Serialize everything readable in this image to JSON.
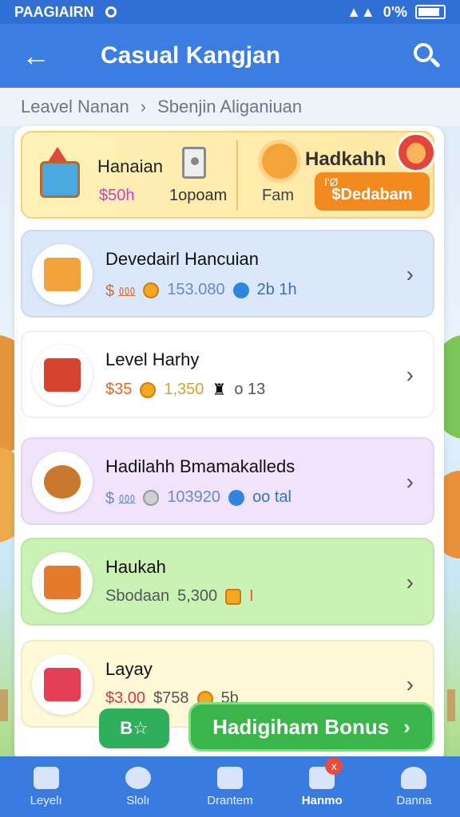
{
  "status": {
    "left_text": "PAAGIAIRN",
    "battery_text": "0'%"
  },
  "appbar": {
    "title": "Casual Kangjan",
    "back_icon": "arrow-left-icon",
    "search_icon": "search-icon"
  },
  "breadcrumb": {
    "first": "Leavel Nanan",
    "second": "Sbenjin Aliganiuan"
  },
  "topcard": {
    "label1": "Hanaian",
    "price1": "$50h",
    "label2": "1opoam",
    "label3": "Hadkahh",
    "label4": "Fam",
    "cta_small": "I'Ø",
    "cta_label": "$Dedabam"
  },
  "items": [
    {
      "name": "Devedairl Hancuian",
      "v1": "$ ⅏",
      "v2": "153.080",
      "v3": "2b 1h",
      "bg": "#dbe7fb"
    },
    {
      "name": "Level Harhy",
      "v1": "$35",
      "v2": "1,350",
      "v3": "o 13",
      "bg": "#ffffff"
    },
    {
      "name": "Hadilahh Bmamakalleds",
      "v1": "$ ⅏",
      "v2": "103920",
      "v3": "oo tal",
      "bg": "#f1e3fb"
    },
    {
      "name": "Haukah",
      "v1": "Sbodaan",
      "v2": "5,300",
      "v3": "I",
      "bg": "#c9f2b4"
    },
    {
      "name": "Layay",
      "v1": "$3.00",
      "v2": "$758",
      "v3": "5b",
      "bg": "#fff9d8"
    }
  ],
  "bonus": {
    "small_label": "B☆",
    "label": "Hadigiham Bonus"
  },
  "nav": {
    "items": [
      {
        "label": "Leyelı",
        "icon": "home-icon"
      },
      {
        "label": "Slolı",
        "icon": "character-icon"
      },
      {
        "label": "Drantem",
        "icon": "gift-icon"
      },
      {
        "label": "Hanmo",
        "icon": "screen-icon",
        "badge": "x"
      },
      {
        "label": "Danna",
        "icon": "profile-icon"
      }
    ]
  }
}
